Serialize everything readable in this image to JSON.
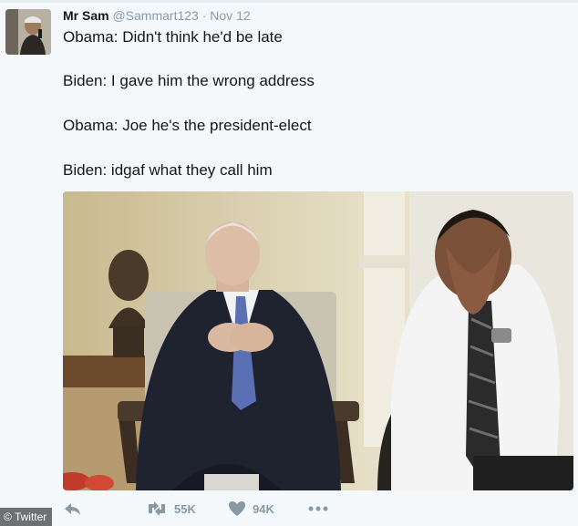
{
  "tweet": {
    "display_name": "Mr Sam",
    "handle": "@Sammart123",
    "separator": "·",
    "date": "Nov 12",
    "lines": [
      "Obama: Didn't think he'd be late",
      "Biden: I gave him the wrong address",
      "Obama: Joe he's the president-elect",
      "Biden: idgaf what they call him"
    ]
  },
  "actions": {
    "reply_icon": "reply-icon",
    "retweet_icon": "retweet-icon",
    "retweet_count": "55K",
    "like_icon": "heart-icon",
    "like_count": "94K",
    "more_icon": "more-icon"
  },
  "watermark": "© Twitter",
  "colors": {
    "muted": "#8899a6",
    "background": "#f5f8fa"
  }
}
